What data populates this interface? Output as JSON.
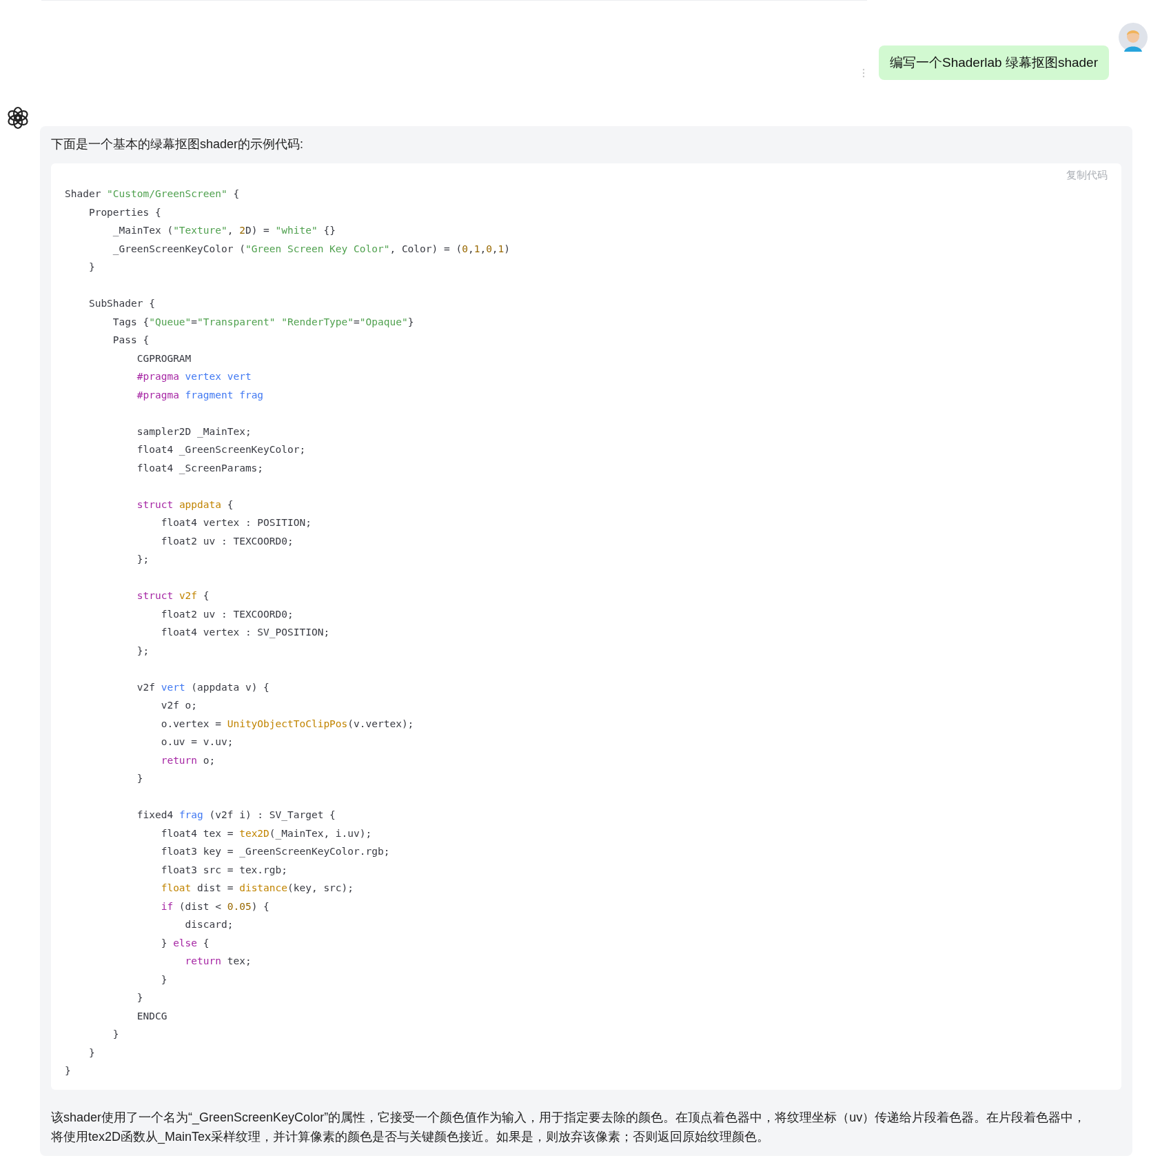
{
  "user_message": {
    "text": "编写一个Shaderlab 绿幕抠图shader"
  },
  "assistant_message": {
    "intro": "下面是一个基本的绿幕抠图shader的示例代码:",
    "code_block": {
      "copy_label": "复制代码",
      "lines": [
        {
          "kind": "code",
          "tokens": [
            {
              "kind": "plain",
              "text": "Shader "
            },
            {
              "kind": "string",
              "text": "\"Custom/GreenScreen\""
            },
            {
              "kind": "plain",
              "text": " {"
            }
          ]
        },
        {
          "kind": "code",
          "tokens": [
            {
              "kind": "plain",
              "text": "    Properties {"
            }
          ]
        },
        {
          "kind": "code",
          "tokens": [
            {
              "kind": "plain",
              "text": "        _MainTex ("
            },
            {
              "kind": "string",
              "text": "\"Texture\""
            },
            {
              "kind": "plain",
              "text": ", "
            },
            {
              "kind": "number",
              "text": "2"
            },
            {
              "kind": "plain",
              "text": "D) = "
            },
            {
              "kind": "string",
              "text": "\"white\""
            },
            {
              "kind": "plain",
              "text": " {}"
            }
          ]
        },
        {
          "kind": "code",
          "tokens": [
            {
              "kind": "plain",
              "text": "        _GreenScreenKeyColor ("
            },
            {
              "kind": "string",
              "text": "\"Green Screen Key Color\""
            },
            {
              "kind": "plain",
              "text": ", Color) = ("
            },
            {
              "kind": "number",
              "text": "0"
            },
            {
              "kind": "plain",
              "text": ","
            },
            {
              "kind": "number",
              "text": "1"
            },
            {
              "kind": "plain",
              "text": ","
            },
            {
              "kind": "number",
              "text": "0"
            },
            {
              "kind": "plain",
              "text": ","
            },
            {
              "kind": "number",
              "text": "1"
            },
            {
              "kind": "plain",
              "text": ")"
            }
          ]
        },
        {
          "kind": "code",
          "tokens": [
            {
              "kind": "plain",
              "text": "    }"
            }
          ]
        },
        {
          "kind": "blank"
        },
        {
          "kind": "code",
          "tokens": [
            {
              "kind": "plain",
              "text": "    SubShader {"
            }
          ]
        },
        {
          "kind": "code",
          "tokens": [
            {
              "kind": "plain",
              "text": "        Tags {"
            },
            {
              "kind": "string",
              "text": "\"Queue\""
            },
            {
              "kind": "plain",
              "text": "="
            },
            {
              "kind": "string",
              "text": "\"Transparent\" \"RenderType\""
            },
            {
              "kind": "plain",
              "text": "="
            },
            {
              "kind": "string",
              "text": "\"Opaque\""
            },
            {
              "kind": "plain",
              "text": "}"
            }
          ]
        },
        {
          "kind": "code",
          "tokens": [
            {
              "kind": "plain",
              "text": "        Pass {"
            }
          ]
        },
        {
          "kind": "code",
          "tokens": [
            {
              "kind": "plain",
              "text": "            CGPROGRAM"
            }
          ]
        },
        {
          "kind": "code",
          "tokens": [
            {
              "kind": "keyword",
              "text": "            #pragma"
            },
            {
              "kind": "title",
              "text": " vertex vert"
            }
          ]
        },
        {
          "kind": "code",
          "tokens": [
            {
              "kind": "keyword",
              "text": "            #pragma"
            },
            {
              "kind": "title",
              "text": " fragment frag"
            }
          ]
        },
        {
          "kind": "blank"
        },
        {
          "kind": "code",
          "tokens": [
            {
              "kind": "plain",
              "text": "            sampler2D _MainTex;"
            }
          ]
        },
        {
          "kind": "code",
          "tokens": [
            {
              "kind": "plain",
              "text": "            float4 _GreenScreenKeyColor;"
            }
          ]
        },
        {
          "kind": "code",
          "tokens": [
            {
              "kind": "plain",
              "text": "            float4 _ScreenParams;"
            }
          ]
        },
        {
          "kind": "blank"
        },
        {
          "kind": "code",
          "tokens": [
            {
              "kind": "keyword",
              "text": "            struct "
            },
            {
              "kind": "builtin",
              "text": "appdata"
            },
            {
              "kind": "plain",
              "text": " {"
            }
          ]
        },
        {
          "kind": "code",
          "tokens": [
            {
              "kind": "plain",
              "text": "                float4 vertex : POSITION;"
            }
          ]
        },
        {
          "kind": "code",
          "tokens": [
            {
              "kind": "plain",
              "text": "                float2 uv : TEXCOORD0;"
            }
          ]
        },
        {
          "kind": "code",
          "tokens": [
            {
              "kind": "plain",
              "text": "            };"
            }
          ]
        },
        {
          "kind": "blank"
        },
        {
          "kind": "code",
          "tokens": [
            {
              "kind": "keyword",
              "text": "            struct "
            },
            {
              "kind": "builtin",
              "text": "v2f"
            },
            {
              "kind": "plain",
              "text": " {"
            }
          ]
        },
        {
          "kind": "code",
          "tokens": [
            {
              "kind": "plain",
              "text": "                float2 uv : TEXCOORD0;"
            }
          ]
        },
        {
          "kind": "code",
          "tokens": [
            {
              "kind": "plain",
              "text": "                float4 vertex : SV_POSITION;"
            }
          ]
        },
        {
          "kind": "code",
          "tokens": [
            {
              "kind": "plain",
              "text": "            };"
            }
          ]
        },
        {
          "kind": "blank"
        },
        {
          "kind": "code",
          "tokens": [
            {
              "kind": "plain",
              "text": "            v2f "
            },
            {
              "kind": "title",
              "text": "vert"
            },
            {
              "kind": "plain",
              "text": " (appdata v) {"
            }
          ]
        },
        {
          "kind": "code",
          "tokens": [
            {
              "kind": "plain",
              "text": "                v2f o;"
            }
          ]
        },
        {
          "kind": "code",
          "tokens": [
            {
              "kind": "plain",
              "text": "                o.vertex = "
            },
            {
              "kind": "builtin",
              "text": "UnityObjectToClipPos"
            },
            {
              "kind": "plain",
              "text": "(v.vertex);"
            }
          ]
        },
        {
          "kind": "code",
          "tokens": [
            {
              "kind": "plain",
              "text": "                o.uv = v.uv;"
            }
          ]
        },
        {
          "kind": "code",
          "tokens": [
            {
              "kind": "keyword",
              "text": "                return"
            },
            {
              "kind": "plain",
              "text": " o;"
            }
          ]
        },
        {
          "kind": "code",
          "tokens": [
            {
              "kind": "plain",
              "text": "            }"
            }
          ]
        },
        {
          "kind": "blank"
        },
        {
          "kind": "code",
          "tokens": [
            {
              "kind": "plain",
              "text": "            fixed4 "
            },
            {
              "kind": "title",
              "text": "frag"
            },
            {
              "kind": "plain",
              "text": " (v2f i) : SV_Target {"
            }
          ]
        },
        {
          "kind": "code",
          "tokens": [
            {
              "kind": "plain",
              "text": "                float4 tex = "
            },
            {
              "kind": "builtin",
              "text": "tex2D"
            },
            {
              "kind": "plain",
              "text": "(_MainTex, i.uv);"
            }
          ]
        },
        {
          "kind": "code",
          "tokens": [
            {
              "kind": "plain",
              "text": "                float3 key = _GreenScreenKeyColor.rgb;"
            }
          ]
        },
        {
          "kind": "code",
          "tokens": [
            {
              "kind": "plain",
              "text": "                float3 src = tex.rgb;"
            }
          ]
        },
        {
          "kind": "code",
          "tokens": [
            {
              "kind": "builtin",
              "text": "                float"
            },
            {
              "kind": "plain",
              "text": " dist = "
            },
            {
              "kind": "builtin",
              "text": "distance"
            },
            {
              "kind": "plain",
              "text": "(key, src);"
            }
          ]
        },
        {
          "kind": "code",
          "tokens": [
            {
              "kind": "keyword",
              "text": "                if"
            },
            {
              "kind": "plain",
              "text": " (dist < "
            },
            {
              "kind": "number",
              "text": "0.05"
            },
            {
              "kind": "plain",
              "text": ") {"
            }
          ]
        },
        {
          "kind": "code",
          "tokens": [
            {
              "kind": "plain",
              "text": "                    discard;"
            }
          ]
        },
        {
          "kind": "code",
          "tokens": [
            {
              "kind": "plain",
              "text": "                } "
            },
            {
              "kind": "keyword",
              "text": "else"
            },
            {
              "kind": "plain",
              "text": " {"
            }
          ]
        },
        {
          "kind": "code",
          "tokens": [
            {
              "kind": "keyword",
              "text": "                    return"
            },
            {
              "kind": "plain",
              "text": " tex;"
            }
          ]
        },
        {
          "kind": "code",
          "tokens": [
            {
              "kind": "plain",
              "text": "                }"
            }
          ]
        },
        {
          "kind": "code",
          "tokens": [
            {
              "kind": "plain",
              "text": "            }"
            }
          ]
        },
        {
          "kind": "code",
          "tokens": [
            {
              "kind": "plain",
              "text": "            ENDCG"
            }
          ]
        },
        {
          "kind": "code",
          "tokens": [
            {
              "kind": "plain",
              "text": "        }"
            }
          ]
        },
        {
          "kind": "code",
          "tokens": [
            {
              "kind": "plain",
              "text": "    }"
            }
          ]
        },
        {
          "kind": "code",
          "tokens": [
            {
              "kind": "plain",
              "text": "}"
            }
          ]
        }
      ]
    },
    "outro": "该shader使用了一个名为“_GreenScreenKeyColor”的属性，它接受一个颜色值作为输入，用于指定要去除的颜色。在顶点着色器中，将纹理坐标（uv）传递给片段着色器。在片段着色器中，将使用tex2D函数从_MainTex采样纹理，并计算像素的颜色是否与关键颜色接近。如果是，则放弃该像素；否则返回原始纹理颜色。"
  }
}
